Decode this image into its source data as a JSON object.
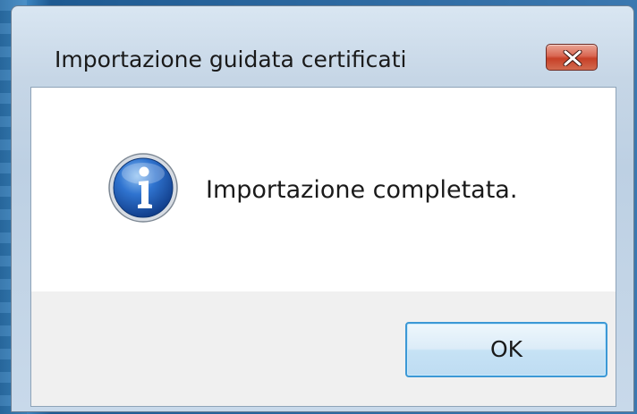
{
  "window": {
    "title": "Importazione guidata certificati",
    "close_icon": "close-icon"
  },
  "dialog": {
    "icon": "info-icon",
    "message": "Importazione completata.",
    "ok_label": "OK"
  },
  "colors": {
    "close_button": "#c74027",
    "ok_button_border": "#3c98d5",
    "info_icon_blue": "#1f5fb8"
  }
}
